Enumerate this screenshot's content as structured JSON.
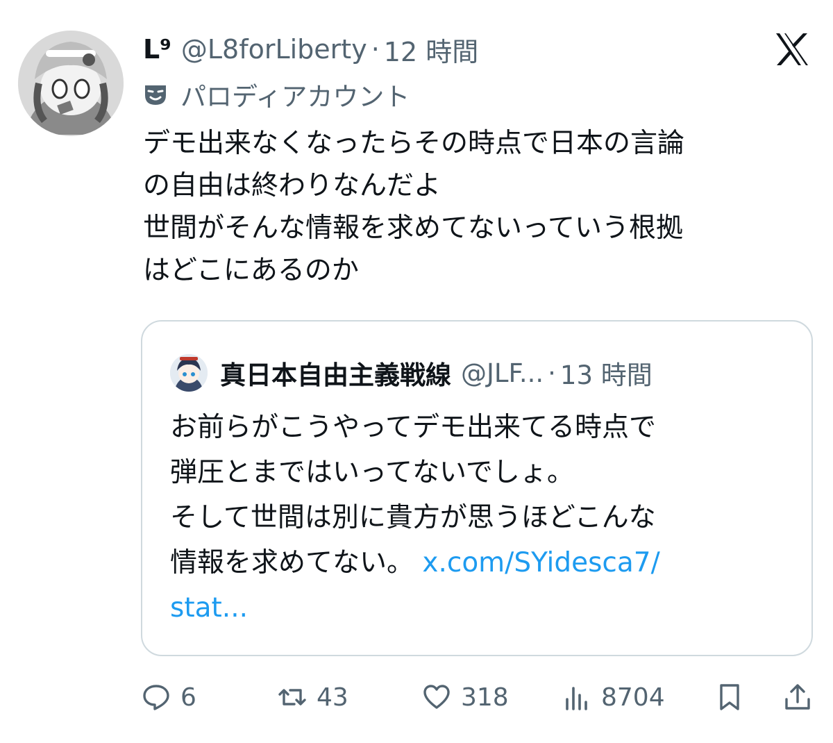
{
  "tweet": {
    "display_name": "L⁹",
    "handle": "@L8forLiberty",
    "separator": "·",
    "time": "12 時間",
    "label": "パロディアカウント",
    "text_lines": [
      "デモ出来なくなったらその時点で日本の言論",
      "の自由は終わりなんだよ",
      "世間がそんな情報を求めてないっていう根拠",
      "はどこにあるのか"
    ]
  },
  "quote": {
    "display_name": "真日本自由主義戦線",
    "handle": "@JLF...",
    "separator": "·",
    "time": "13 時間",
    "text_lines": [
      "お前らがこうやってデモ出来てる時点で",
      "弾圧とまではいってないでしょ。",
      "そして世間は別に貴方が思うほどこんな"
    ],
    "last_line_text": "情報を求めてない。 ",
    "link_part1": "x.com/SYidesca7/",
    "link_part2": "stat..."
  },
  "actions": {
    "replies": "6",
    "reposts": "43",
    "likes": "318",
    "views": "8704"
  },
  "icons": {
    "platform": "x-logo-icon",
    "label": "theater-mask-icon",
    "reply": "reply-icon",
    "repost": "repost-icon",
    "like": "heart-icon",
    "views": "views-icon",
    "bookmark": "bookmark-icon",
    "share": "share-icon"
  },
  "colors": {
    "text": "#0f1419",
    "secondary": "#536471",
    "link": "#1d9bf0",
    "border": "#cfd9de"
  }
}
